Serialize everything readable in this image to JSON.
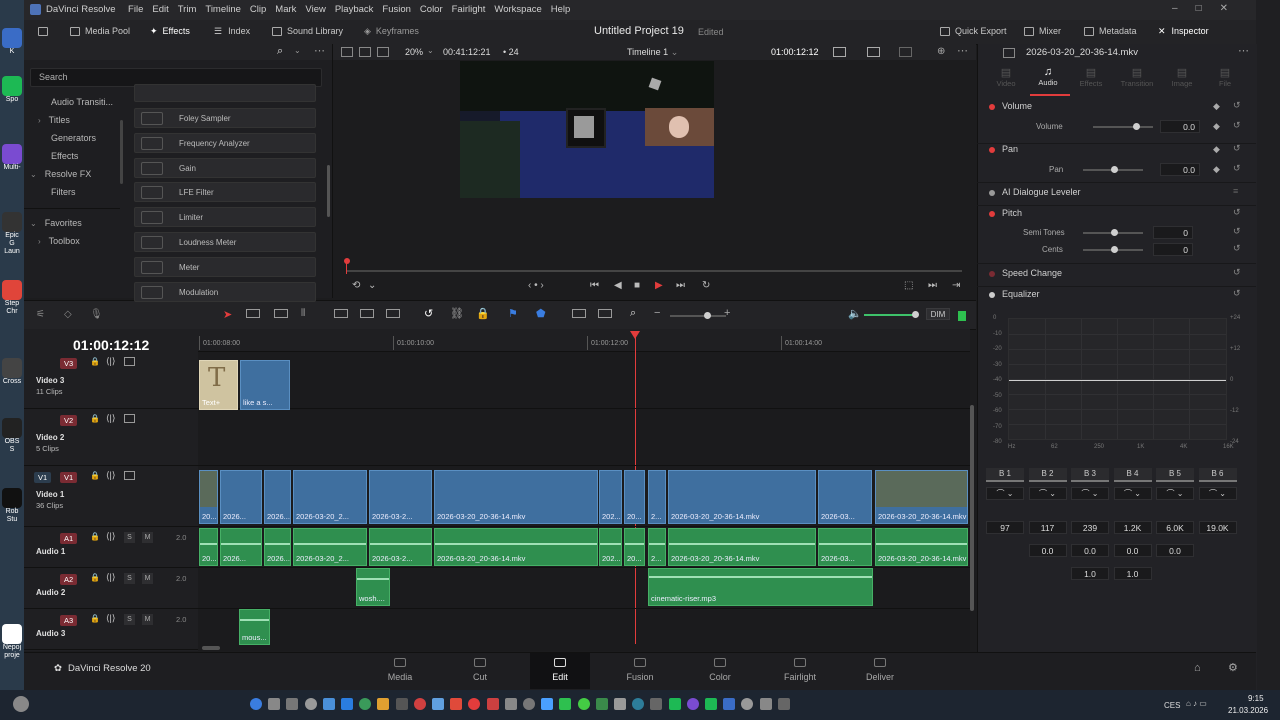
{
  "desktop": {
    "icons": [
      {
        "label": "K",
        "color": "#3a6cc6"
      },
      {
        "label": "Spo",
        "color": "#1db954"
      },
      {
        "label": "Multi-",
        "color": "#7a4bd1"
      },
      {
        "label": "Epic G Laun",
        "color": "#333333"
      },
      {
        "label": "Step Chr",
        "color": "#e0453a"
      },
      {
        "label": "Cross",
        "color": "#444444"
      },
      {
        "label": "OBS S",
        "color": "#222222"
      },
      {
        "label": "Rob Stu",
        "color": "#111111"
      },
      {
        "label": "Nepoj proje",
        "color": "#ffffff"
      }
    ]
  },
  "window": {
    "app_name": "DaVinci Resolve",
    "menu": [
      "File",
      "Edit",
      "Trim",
      "Timeline",
      "Clip",
      "Mark",
      "View",
      "Playback",
      "Fusion",
      "Color",
      "Fairlight",
      "Workspace",
      "Help"
    ],
    "project_title": "Untitled Project 19",
    "project_status": "Edited"
  },
  "toolbar": {
    "media_pool": "Media Pool",
    "effects": "Effects",
    "index": "Index",
    "sound_library": "Sound Library",
    "keyframes": "Keyframes",
    "quick_export": "Quick Export",
    "mixer": "Mixer",
    "metadata": "Metadata",
    "inspector": "Inspector"
  },
  "effects_panel": {
    "search_placeholder": "Search",
    "tree": [
      {
        "label": "Audio Transiti...",
        "indent": 1
      },
      {
        "label": "Titles",
        "indent": 1,
        "arrow": true
      },
      {
        "label": "Generators",
        "indent": 1
      },
      {
        "label": "Effects",
        "indent": 1
      },
      {
        "label": "Resolve FX",
        "indent": 0,
        "arrow": true
      },
      {
        "label": "Filters",
        "indent": 1
      },
      {
        "label": "Favorites",
        "indent": 0,
        "arrow": true
      },
      {
        "label": "Toolbox",
        "indent": 1,
        "arrow": true
      }
    ],
    "effects": [
      "Foley Sampler",
      "Frequency Analyzer",
      "Gain",
      "LFE Filter",
      "Limiter",
      "Loudness Meter",
      "Meter",
      "Modulation"
    ]
  },
  "viewer": {
    "zoom": "20%",
    "source_timecode": "00:41:12:21",
    "frame_rate": "24",
    "timeline_name": "Timeline 1",
    "record_timecode": "01:00:12:12"
  },
  "inspector": {
    "clip_name": "2026-03-20_20-36-14.mkv",
    "tabs": [
      "Video",
      "Audio",
      "Effects",
      "Transition",
      "Image",
      "File"
    ],
    "active_tab": "Audio",
    "volume": {
      "title": "Volume",
      "label": "Volume",
      "value": "0.0"
    },
    "pan": {
      "title": "Pan",
      "label": "Pan",
      "value": "0.0"
    },
    "dialogue": {
      "title": "AI Dialogue Leveler"
    },
    "pitch": {
      "title": "Pitch",
      "semitones_label": "Semi Tones",
      "semitones": "0",
      "cents_label": "Cents",
      "cents": "0"
    },
    "speed_change": {
      "title": "Speed Change"
    },
    "equalizer": {
      "title": "Equalizer",
      "y_left": [
        "0",
        "-6",
        "-12",
        "-18",
        "-24",
        "-30",
        "-36",
        "-42",
        "-48",
        "-54",
        "-60",
        "-66",
        "-72",
        "-78",
        "-84",
        "-90",
        "-96",
        "-102",
        "-108",
        "-114",
        "-120"
      ],
      "y_left_visible": [
        "0",
        "-10",
        "-20",
        "-30",
        "-40",
        "-50",
        "-60",
        "-70",
        "-80"
      ],
      "y_right_visible": [
        "+24",
        "+12",
        "0",
        "-12",
        "-24"
      ],
      "x_labels": [
        "Hz",
        "62",
        "250",
        "1K",
        "4K",
        "16K"
      ],
      "bands": [
        "B 1",
        "B 2",
        "B 3",
        "B 4",
        "B 5",
        "B 6"
      ],
      "freqs": [
        "97",
        "117",
        "239",
        "1.2K",
        "6.0K",
        "19.0K"
      ],
      "gains": [
        "",
        "0.0",
        "0.0",
        "0.0",
        "0.0",
        ""
      ],
      "q": [
        "",
        "",
        "1.0",
        "1.0",
        "",
        ""
      ]
    }
  },
  "timeline": {
    "timecode": "01:00:12:12",
    "ruler": [
      "01:00:08:00",
      "01:00:10:00",
      "01:00:12:00",
      "01:00:14:00"
    ],
    "dim_label": "DIM",
    "tracks": [
      {
        "id": "V3",
        "name": "Video 3",
        "sub": "11 Clips"
      },
      {
        "id": "V2",
        "name": "Video 2",
        "sub": "5 Clips"
      },
      {
        "id": "V1",
        "name": "Video 1",
        "sub": "36 Clips",
        "src": "V1"
      },
      {
        "id": "A1",
        "name": "Audio 1",
        "sub": "2.0",
        "src": ""
      },
      {
        "id": "A2",
        "name": "Audio 2",
        "sub": "2.0"
      },
      {
        "id": "A3",
        "name": "Audio 3",
        "sub": "2.0"
      }
    ],
    "v3_clips": [
      "Text+",
      "like a s..."
    ],
    "v1_clips": [
      "20...",
      "2026...",
      "2026...",
      "2026-03-20_2...",
      "2026-03-2...",
      "2026-03-20_20-36-14.mkv",
      "202...",
      "20...",
      "2...",
      "2026-03-20_20-36-14.mkv",
      "2026-03...",
      "2026-03-20_20-36-14.mkv"
    ],
    "a1_clips": [
      "20...",
      "2026...",
      "2026...",
      "2026-03-20_2...",
      "2026-03-2...",
      "2026-03-20_20-36-14.mkv",
      "202...",
      "20...",
      "2...",
      "2026-03-20_20-36-14.mkv",
      "2026-03...",
      "2026-03-20_20-36-14.mkv"
    ],
    "a2_clips": [
      "wosh....",
      "cinematic-riser.mp3"
    ],
    "a3_clips": [
      "mous..."
    ],
    "s_label": "S",
    "m_label": "M"
  },
  "pages": {
    "brand": "DaVinci Resolve 20",
    "tabs": [
      "Media",
      "Cut",
      "Edit",
      "Fusion",
      "Color",
      "Fairlight",
      "Deliver"
    ],
    "active": "Edit"
  },
  "taskbar": {
    "lang": "CES",
    "time": "9:15",
    "date": "21.03.2026"
  },
  "colors": {
    "accent": "#e23c3c",
    "video_clip": "#3f6f9f",
    "audio_clip": "#2f8f4f",
    "playhead": "#e23c3c"
  }
}
